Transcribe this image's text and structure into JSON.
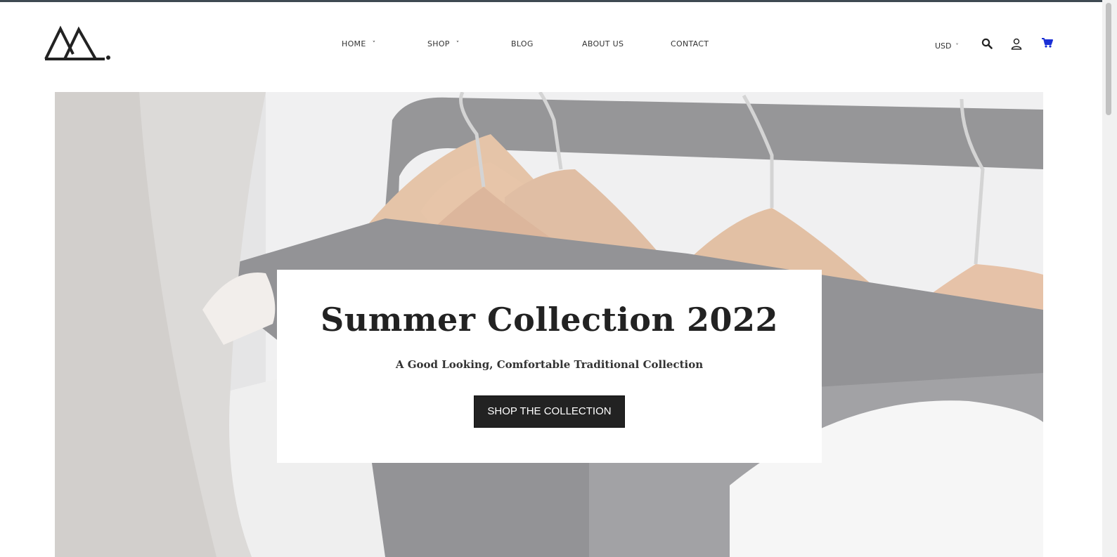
{
  "brand": {
    "logo_icon": "mountain-logo-icon"
  },
  "nav": {
    "items": [
      {
        "label": "HOME",
        "has_dropdown": true
      },
      {
        "label": "SHOP",
        "has_dropdown": true
      },
      {
        "label": "BLOG",
        "has_dropdown": false
      },
      {
        "label": "ABOUT US",
        "has_dropdown": false
      },
      {
        "label": "CONTACT",
        "has_dropdown": false
      }
    ],
    "dropdown_glyph": "˅"
  },
  "header_tools": {
    "currency": "USD",
    "currency_glyph": "˅",
    "search_icon": "search-icon",
    "account_icon": "user-icon",
    "cart_icon": "cart-icon",
    "cart_color": "#1a2fd6"
  },
  "hero": {
    "title": "Summer Collection 2022",
    "subtitle": "A Good Looking, Comfortable Traditional Collection",
    "cta": "SHOP THE COLLECTION"
  },
  "colors": {
    "top_strip": "#3f4a52",
    "button_bg": "#222222",
    "card_bg": "#ffffff"
  }
}
